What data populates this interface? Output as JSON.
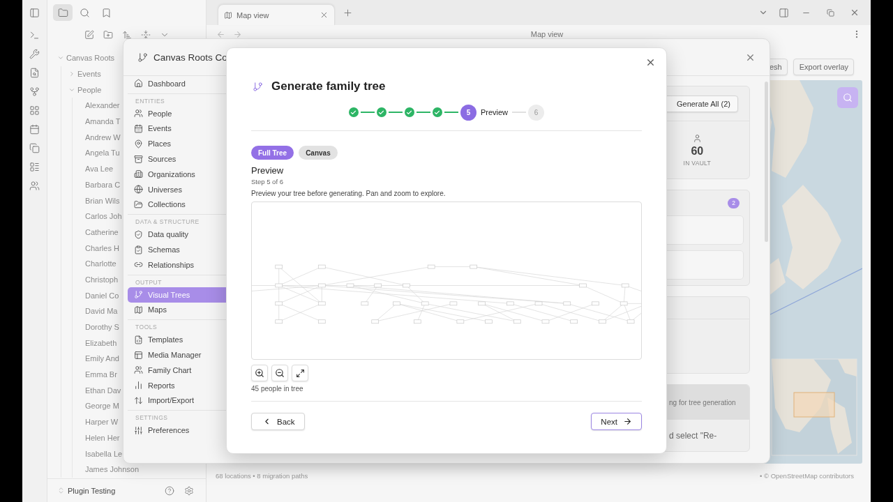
{
  "explorer": {
    "tabs": [
      {
        "kind": "files",
        "selected": true
      },
      {
        "kind": "search",
        "selected": false
      },
      {
        "kind": "bookmarks",
        "selected": false
      }
    ],
    "tree": [
      {
        "label": "Canvas Roots",
        "expanded": true,
        "children": [
          {
            "label": "Events",
            "expanded": false
          },
          {
            "label": "People",
            "expanded": true,
            "children": [
              {
                "label": "Alexander"
              },
              {
                "label": "Amanda T"
              },
              {
                "label": "Andrew W"
              },
              {
                "label": "Angela Tu"
              },
              {
                "label": "Ava Lee"
              },
              {
                "label": "Barbara C"
              },
              {
                "label": "Brian Wils"
              },
              {
                "label": "Carlos Joh"
              },
              {
                "label": "Catherine"
              },
              {
                "label": "Charles H"
              },
              {
                "label": "Charlotte"
              },
              {
                "label": "Christoph"
              },
              {
                "label": "Daniel Co"
              },
              {
                "label": "David Ma"
              },
              {
                "label": "Dorothy S"
              },
              {
                "label": "Elizabeth"
              },
              {
                "label": "Emily And"
              },
              {
                "label": "Emma Br"
              },
              {
                "label": "Ethan Dav"
              },
              {
                "label": "George M"
              },
              {
                "label": "Harper W"
              },
              {
                "label": "Helen Her"
              },
              {
                "label": "Isabella Le"
              },
              {
                "label": "James Johnson"
              }
            ]
          }
        ]
      }
    ],
    "vault": "Plugin Testing"
  },
  "tabs": [
    {
      "label": "Map view",
      "selected": true
    }
  ],
  "view_header": {
    "title": "Map view"
  },
  "map_toolbar": {
    "buttons": [
      "esh",
      "Export overlay"
    ]
  },
  "map_footer": {
    "summary": "68 locations • 8 migration paths",
    "attribution": "• © OpenStreetMap contributors"
  },
  "control_center": {
    "title": "Canvas Roots Co",
    "nav": [
      {
        "items": [
          {
            "label": "Dashboard",
            "selected": false
          }
        ]
      },
      {
        "heading": "ENTITIES",
        "items": [
          {
            "label": "People",
            "selected": false
          },
          {
            "label": "Events",
            "selected": false
          },
          {
            "label": "Places",
            "selected": false
          },
          {
            "label": "Sources",
            "selected": false
          },
          {
            "label": "Organizations",
            "selected": false
          },
          {
            "label": "Universes",
            "selected": false
          },
          {
            "label": "Collections",
            "selected": false
          }
        ]
      },
      {
        "heading": "DATA & STRUCTURE",
        "items": [
          {
            "label": "Data quality",
            "selected": false
          },
          {
            "label": "Schemas",
            "selected": false
          },
          {
            "label": "Relationships",
            "selected": false
          }
        ]
      },
      {
        "heading": "OUTPUT",
        "items": [
          {
            "label": "Visual Trees",
            "selected": true
          },
          {
            "label": "Maps",
            "selected": false
          }
        ]
      },
      {
        "heading": "TOOLS",
        "items": [
          {
            "label": "Templates",
            "selected": false
          },
          {
            "label": "Media Manager",
            "selected": false
          },
          {
            "label": "Family Chart",
            "selected": false
          },
          {
            "label": "Reports",
            "selected": false
          },
          {
            "label": "Import/Export",
            "selected": false
          }
        ]
      },
      {
        "heading": "SETTINGS",
        "items": [
          {
            "label": "Preferences",
            "selected": false
          }
        ]
      }
    ],
    "panel": {
      "generate_button": "Generate All (2)",
      "stat_value": "60",
      "stat_label": "IN VAULT",
      "badge": "2",
      "notice": "ng for tree generation",
      "hint": "d select \"Re-"
    }
  },
  "dialog": {
    "title": "Generate family tree",
    "steps": [
      {
        "kind": "done"
      },
      {
        "kind": "done"
      },
      {
        "kind": "done"
      },
      {
        "kind": "done"
      },
      {
        "kind": "current",
        "number": "5",
        "label": "Preview"
      },
      {
        "kind": "upcoming",
        "number": "6"
      }
    ],
    "modes": [
      {
        "label": "Full Tree",
        "selected": true
      },
      {
        "label": "Canvas",
        "selected": false
      }
    ],
    "heading": "Preview",
    "step_caption": "Step 5 of 6",
    "description": "Preview your tree before generating. Pan and zoom to explore.",
    "people_count": "45 people in tree",
    "back": "Back",
    "next": "Next"
  }
}
